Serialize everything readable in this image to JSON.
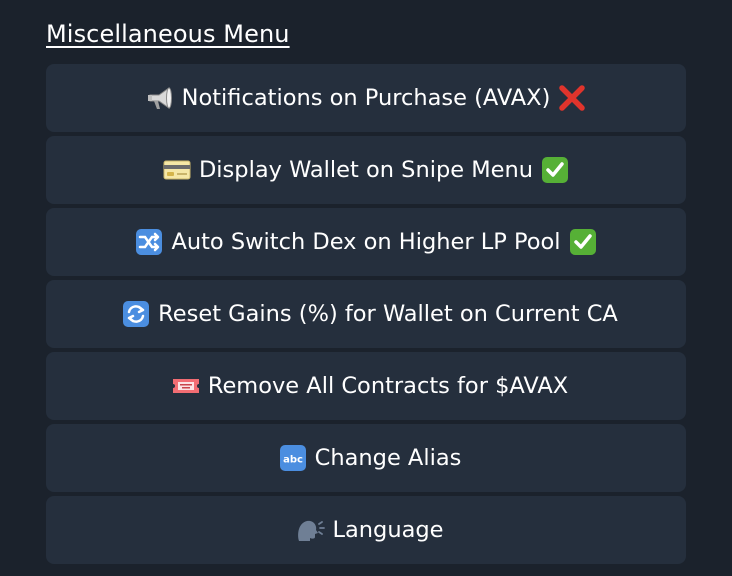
{
  "menu": {
    "title": "Miscellaneous Menu",
    "items": [
      {
        "label": "Notifications on Purchase (AVAX)",
        "icon": "megaphone-icon",
        "status_icon": "cross-mark-icon"
      },
      {
        "label": "Display Wallet on Snipe Menu",
        "icon": "credit-card-icon",
        "status_icon": "check-mark-icon"
      },
      {
        "label": "Auto Switch Dex on Higher LP Pool",
        "icon": "shuffle-icon",
        "status_icon": "check-mark-icon"
      },
      {
        "label": "Reset Gains (%) for Wallet on Current CA",
        "icon": "refresh-icon"
      },
      {
        "label": "Remove All Contracts for $AVAX",
        "icon": "ticket-icon"
      },
      {
        "label": "Change Alias",
        "icon": "abc-icon"
      },
      {
        "label": "Language",
        "icon": "speaking-head-icon"
      }
    ]
  },
  "colors": {
    "background": "#1b222c",
    "button": "#252f3d",
    "text": "#ffffff",
    "cross": "#e0342c",
    "check": "#56b036",
    "blue_icon": "#4b8ee0"
  }
}
